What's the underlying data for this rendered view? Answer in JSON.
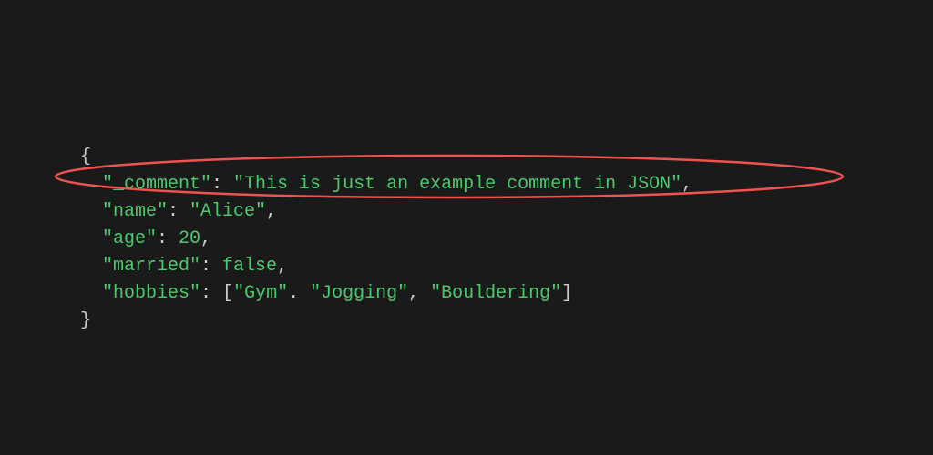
{
  "code": {
    "open_brace": "{",
    "line1": {
      "key_full": "\"_comment\"",
      "colon": ": ",
      "value_full": "\"This is just an example comment in JSON\"",
      "comma": ","
    },
    "line2": {
      "key_full": "\"name\"",
      "colon": ": ",
      "value_full": "\"Alice\"",
      "comma": ","
    },
    "line3": {
      "key_full": "\"age\"",
      "colon": ": ",
      "value_full": "20",
      "comma": ","
    },
    "line4": {
      "key_full": "\"married\"",
      "colon": ": ",
      "value_full": "false",
      "comma": ","
    },
    "line5": {
      "key_full": "\"hobbies\"",
      "colon": ": ",
      "bracket_open": "[",
      "item1": "\"Gym\"",
      "sep1": ". ",
      "item2": "\"Jogging\"",
      "sep2": ", ",
      "item3": "\"Bouldering\"",
      "bracket_close": "]"
    },
    "close_brace": "}"
  },
  "annotation": {
    "color": "#ef5350"
  }
}
